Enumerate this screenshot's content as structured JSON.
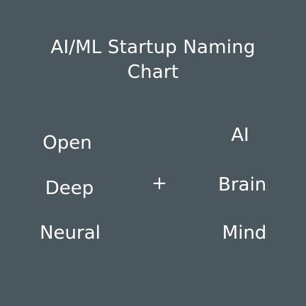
{
  "title": {
    "line1": "AI/ML Startup Naming",
    "line2": "Chart"
  },
  "columns": {
    "prefixes": [
      "Open",
      "Deep",
      "Neural"
    ],
    "operator": "+",
    "suffixes": [
      "AI",
      "Brain",
      "Mind"
    ]
  },
  "colors": {
    "background": "#4a575e",
    "text": "#ffffff"
  }
}
